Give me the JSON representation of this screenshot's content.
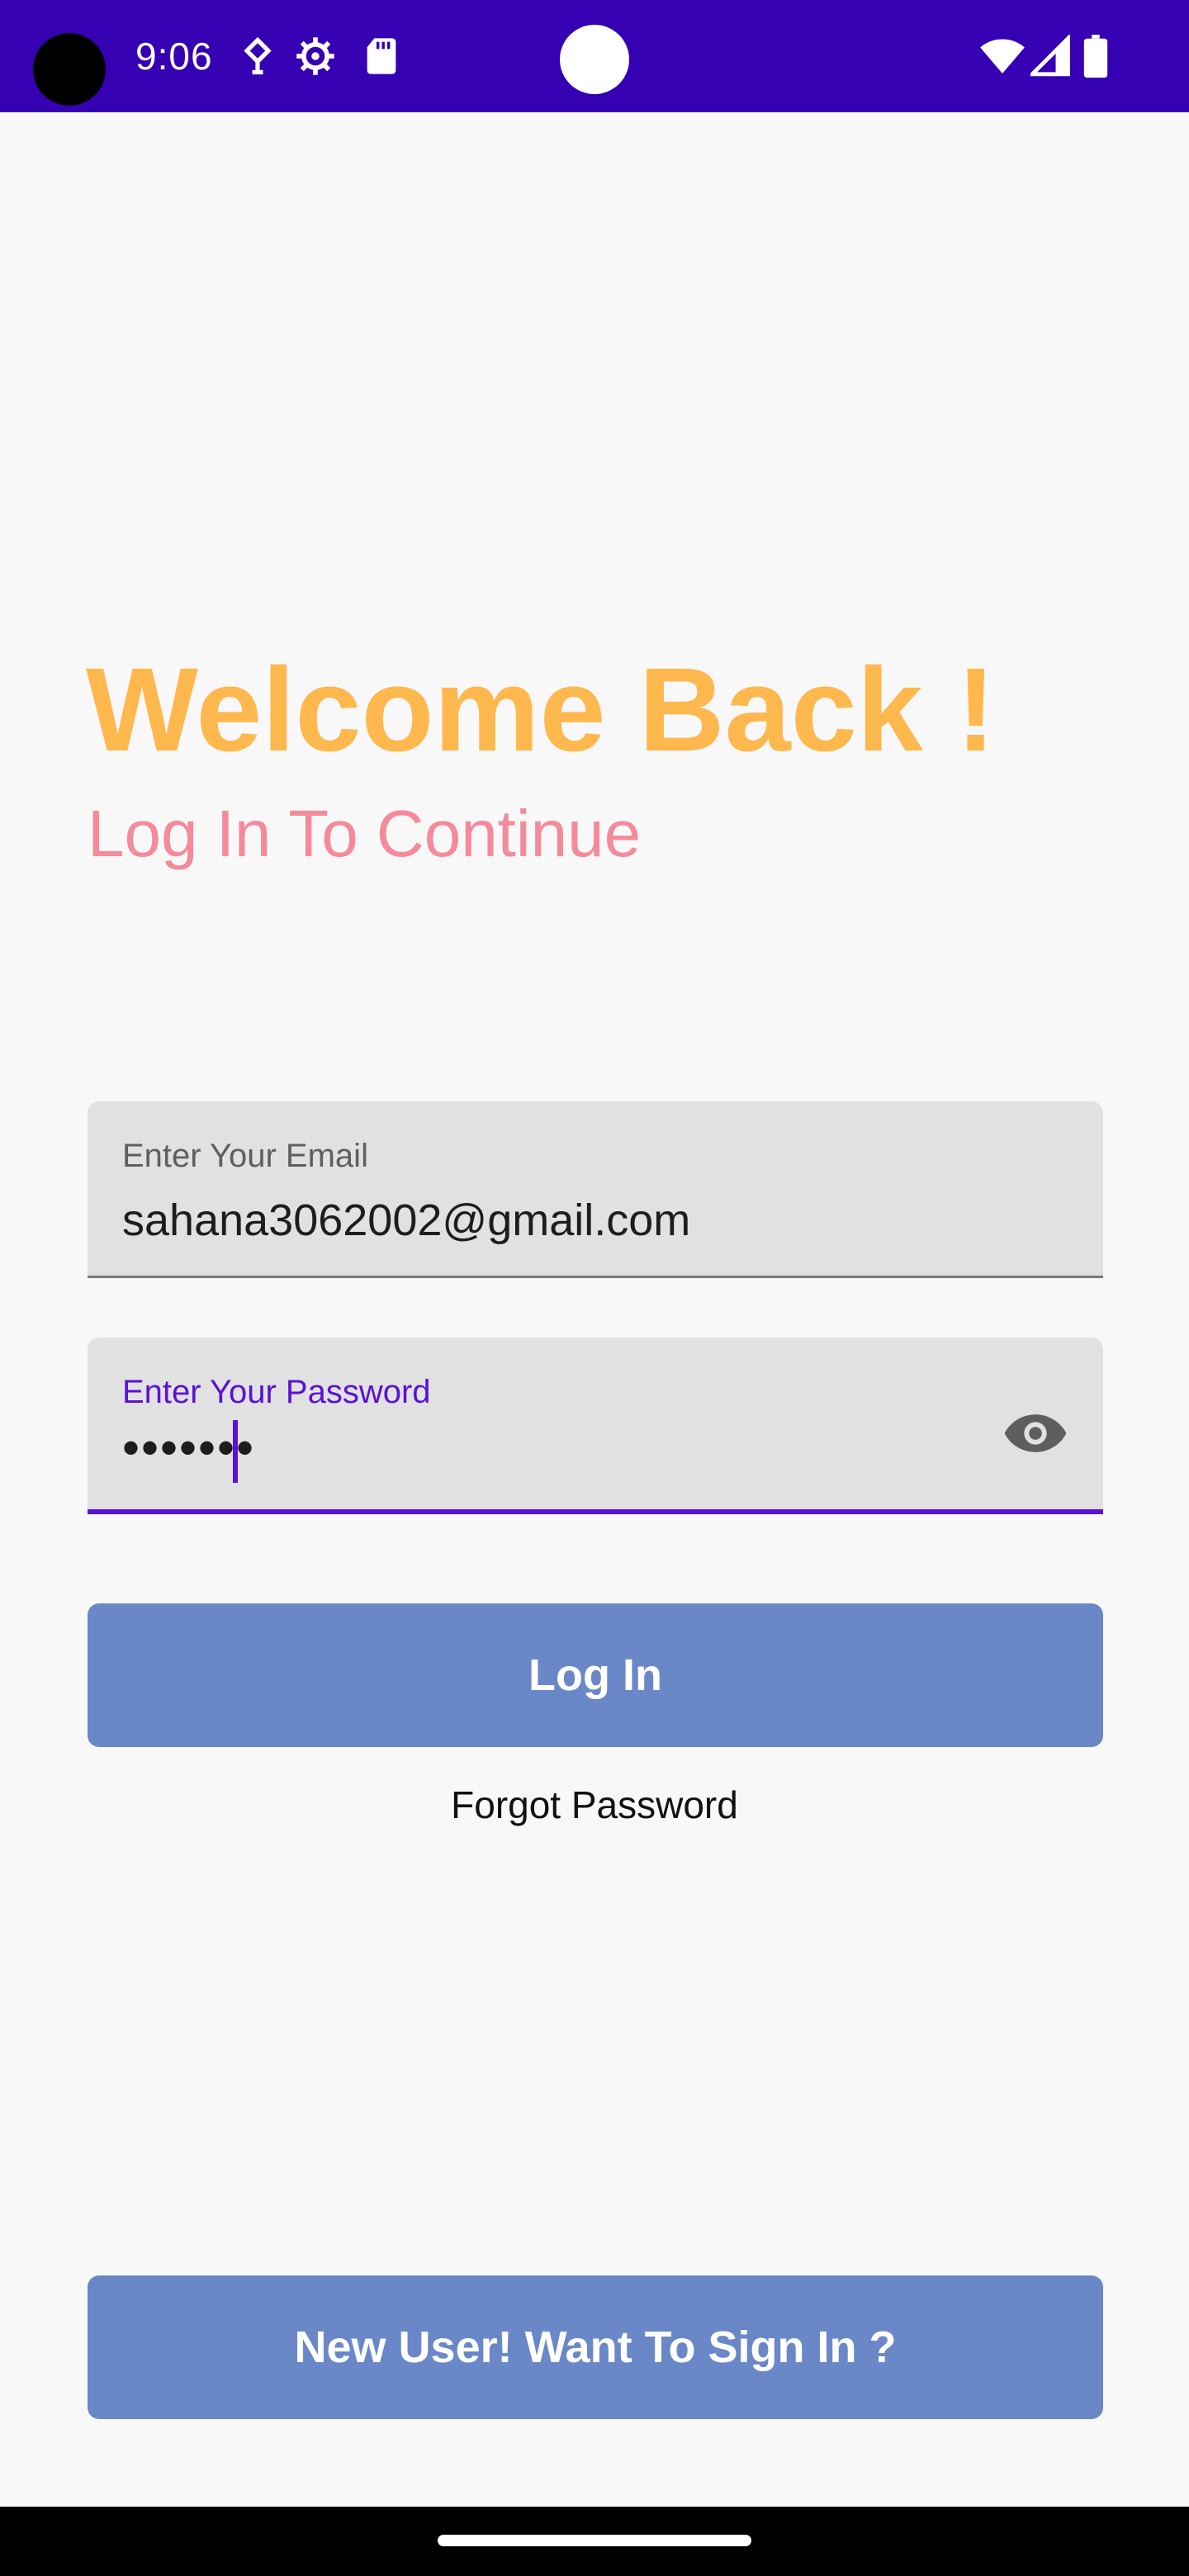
{
  "status_bar": {
    "time": "9:06",
    "left_icons": [
      "vpn-key-icon",
      "settings-gear-icon",
      "sd-card-icon"
    ],
    "right_icons": [
      "wifi-icon",
      "signal-icon",
      "battery-icon"
    ],
    "background_color": "#3600b3"
  },
  "header": {
    "title": "Welcome Back !",
    "subtitle": "Log In To Continue",
    "title_color": "#ffb84d",
    "subtitle_color": "#f48a9a"
  },
  "email_field": {
    "label": "Enter Your Email",
    "value": "sahana3062002@gmail.com"
  },
  "password_field": {
    "label": "Enter Your Password",
    "value": "•••••••",
    "toggle_icon": "eye-icon",
    "accent_color": "#5b11d6"
  },
  "login_button": {
    "label": "Log In",
    "color": "#6a88c7"
  },
  "forgot_password": {
    "label": "Forgot Password"
  },
  "signup_button": {
    "label": "New User! Want To Sign In ?"
  }
}
